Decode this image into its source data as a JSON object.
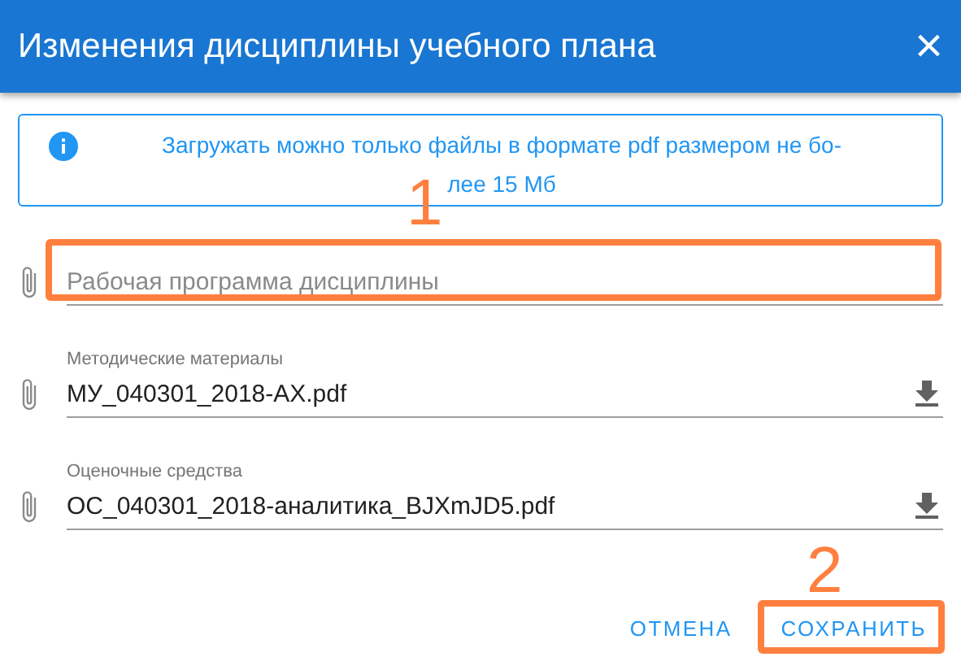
{
  "window": {
    "title": "Изменения дисциплины учебного плана",
    "close": "×"
  },
  "notice": {
    "lines": [
      "Загружать можно только файлы в формате pdf размером не бо-",
      "лее 15 Мб"
    ]
  },
  "fields": [
    {
      "placeholder": "Рабочая программа дисциплины"
    },
    {
      "label": "Методические материалы",
      "value": "МУ_040301_2018-АХ.pdf"
    },
    {
      "label": "Оценочные средства",
      "value": "ОС_040301_2018-аналитика_BJXmJD5.pdf"
    }
  ],
  "buttons": [
    {
      "label": "ОТМЕНА"
    },
    {
      "label": "СОХРАНИТЬ"
    }
  ],
  "annotations": [
    {
      "label": "1"
    },
    {
      "label": "2"
    }
  ]
}
